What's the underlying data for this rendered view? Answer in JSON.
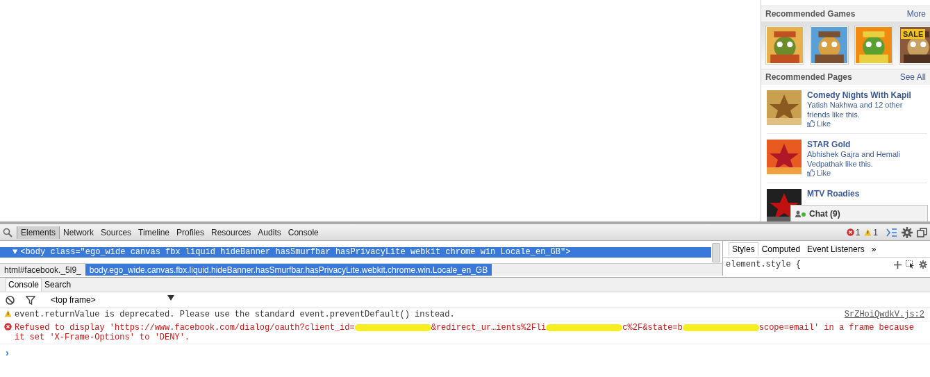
{
  "sidebar": {
    "games": {
      "title": "Recommended Games",
      "link": "More",
      "thumbnails": [
        {
          "kind": "picture"
        },
        {
          "kind": "picture"
        },
        {
          "kind": "picture"
        },
        {
          "kind": "picture",
          "badge": "SALE"
        }
      ]
    },
    "pages": {
      "title": "Recommended Pages",
      "link": "See All",
      "items": [
        {
          "name": "Comedy Nights With Kapil",
          "text": "Yatish Nakhwa and 12 other friends like this.",
          "like": "Like"
        },
        {
          "name": "STAR Gold",
          "text": "Abhishek Gajra and Hemali Vedpathak like this.",
          "like": "Like"
        },
        {
          "name": "MTV Roadies"
        }
      ]
    },
    "chat": {
      "label": "Chat (9)"
    }
  },
  "devtools": {
    "tabs": [
      {
        "label": "Elements",
        "selected": true
      },
      {
        "label": "Network",
        "selected": false
      },
      {
        "label": "Sources",
        "selected": false
      },
      {
        "label": "Timeline",
        "selected": false
      },
      {
        "label": "Profiles",
        "selected": false
      },
      {
        "label": "Resources",
        "selected": false
      },
      {
        "label": "Audits",
        "selected": false
      },
      {
        "label": "Console",
        "selected": false
      }
    ],
    "error_count": "1",
    "warning_count": "1",
    "dom_lines": [
      {
        "text": "<body class=\"ego_wide canvas fbx liquid hideBanner hasSmurfbar hasPrivacyLite webkit chrome win Locale_en_GB\">",
        "arrow": "▼",
        "selected": true
      }
    ],
    "breadcrumbs": [
      {
        "label": "html#facebook._5l9_",
        "selected": false
      },
      {
        "label": "body.ego_wide.canvas.fbx.liquid.hideBanner.hasSmurfbar.hasPrivacyLite.webkit.chrome.win.Locale_en_GB",
        "selected": true
      }
    ],
    "style_tabs": [
      {
        "label": "Styles",
        "selected": true
      },
      {
        "label": "Computed",
        "selected": false
      },
      {
        "label": "Event Listeners",
        "selected": false
      }
    ],
    "more_tabs": "»",
    "style_rule": "element.style {",
    "console_tabs": [
      {
        "label": "Console",
        "selected": true
      },
      {
        "label": "Search",
        "selected": false
      }
    ],
    "frame": "<top frame>",
    "messages": [
      {
        "kind": "warning",
        "segments": [
          {
            "kind": "text",
            "text": "event.returnValue is deprecated. Please use the standard event.preventDefault() instead."
          }
        ],
        "source": "SrZHoiQwdkV.js:2"
      },
      {
        "kind": "error",
        "segments": [
          {
            "kind": "text",
            "text": "Refused to display 'https://www.facebook.com/dialog/oauth?client_id="
          },
          {
            "kind": "redaction"
          },
          {
            "kind": "text",
            "text": "&redirect_ur…ients%2Fli"
          },
          {
            "kind": "redaction"
          },
          {
            "kind": "text",
            "text": "c%2F&state=b"
          },
          {
            "kind": "redaction"
          },
          {
            "kind": "text",
            "text": "scope=email' in a frame because it set 'X-Frame-Options' to 'DENY'."
          }
        ]
      }
    ],
    "prompt": "›"
  }
}
